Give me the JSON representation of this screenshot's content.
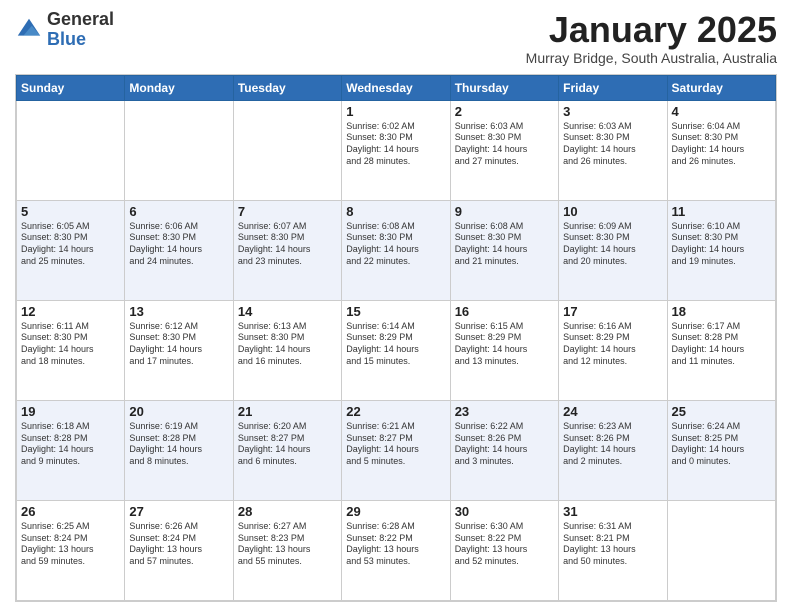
{
  "logo": {
    "general": "General",
    "blue": "Blue"
  },
  "title": "January 2025",
  "location": "Murray Bridge, South Australia, Australia",
  "weekdays": [
    "Sunday",
    "Monday",
    "Tuesday",
    "Wednesday",
    "Thursday",
    "Friday",
    "Saturday"
  ],
  "weeks": [
    [
      {
        "day": "",
        "info": ""
      },
      {
        "day": "",
        "info": ""
      },
      {
        "day": "",
        "info": ""
      },
      {
        "day": "1",
        "info": "Sunrise: 6:02 AM\nSunset: 8:30 PM\nDaylight: 14 hours\nand 28 minutes."
      },
      {
        "day": "2",
        "info": "Sunrise: 6:03 AM\nSunset: 8:30 PM\nDaylight: 14 hours\nand 27 minutes."
      },
      {
        "day": "3",
        "info": "Sunrise: 6:03 AM\nSunset: 8:30 PM\nDaylight: 14 hours\nand 26 minutes."
      },
      {
        "day": "4",
        "info": "Sunrise: 6:04 AM\nSunset: 8:30 PM\nDaylight: 14 hours\nand 26 minutes."
      }
    ],
    [
      {
        "day": "5",
        "info": "Sunrise: 6:05 AM\nSunset: 8:30 PM\nDaylight: 14 hours\nand 25 minutes."
      },
      {
        "day": "6",
        "info": "Sunrise: 6:06 AM\nSunset: 8:30 PM\nDaylight: 14 hours\nand 24 minutes."
      },
      {
        "day": "7",
        "info": "Sunrise: 6:07 AM\nSunset: 8:30 PM\nDaylight: 14 hours\nand 23 minutes."
      },
      {
        "day": "8",
        "info": "Sunrise: 6:08 AM\nSunset: 8:30 PM\nDaylight: 14 hours\nand 22 minutes."
      },
      {
        "day": "9",
        "info": "Sunrise: 6:08 AM\nSunset: 8:30 PM\nDaylight: 14 hours\nand 21 minutes."
      },
      {
        "day": "10",
        "info": "Sunrise: 6:09 AM\nSunset: 8:30 PM\nDaylight: 14 hours\nand 20 minutes."
      },
      {
        "day": "11",
        "info": "Sunrise: 6:10 AM\nSunset: 8:30 PM\nDaylight: 14 hours\nand 19 minutes."
      }
    ],
    [
      {
        "day": "12",
        "info": "Sunrise: 6:11 AM\nSunset: 8:30 PM\nDaylight: 14 hours\nand 18 minutes."
      },
      {
        "day": "13",
        "info": "Sunrise: 6:12 AM\nSunset: 8:30 PM\nDaylight: 14 hours\nand 17 minutes."
      },
      {
        "day": "14",
        "info": "Sunrise: 6:13 AM\nSunset: 8:30 PM\nDaylight: 14 hours\nand 16 minutes."
      },
      {
        "day": "15",
        "info": "Sunrise: 6:14 AM\nSunset: 8:29 PM\nDaylight: 14 hours\nand 15 minutes."
      },
      {
        "day": "16",
        "info": "Sunrise: 6:15 AM\nSunset: 8:29 PM\nDaylight: 14 hours\nand 13 minutes."
      },
      {
        "day": "17",
        "info": "Sunrise: 6:16 AM\nSunset: 8:29 PM\nDaylight: 14 hours\nand 12 minutes."
      },
      {
        "day": "18",
        "info": "Sunrise: 6:17 AM\nSunset: 8:28 PM\nDaylight: 14 hours\nand 11 minutes."
      }
    ],
    [
      {
        "day": "19",
        "info": "Sunrise: 6:18 AM\nSunset: 8:28 PM\nDaylight: 14 hours\nand 9 minutes."
      },
      {
        "day": "20",
        "info": "Sunrise: 6:19 AM\nSunset: 8:28 PM\nDaylight: 14 hours\nand 8 minutes."
      },
      {
        "day": "21",
        "info": "Sunrise: 6:20 AM\nSunset: 8:27 PM\nDaylight: 14 hours\nand 6 minutes."
      },
      {
        "day": "22",
        "info": "Sunrise: 6:21 AM\nSunset: 8:27 PM\nDaylight: 14 hours\nand 5 minutes."
      },
      {
        "day": "23",
        "info": "Sunrise: 6:22 AM\nSunset: 8:26 PM\nDaylight: 14 hours\nand 3 minutes."
      },
      {
        "day": "24",
        "info": "Sunrise: 6:23 AM\nSunset: 8:26 PM\nDaylight: 14 hours\nand 2 minutes."
      },
      {
        "day": "25",
        "info": "Sunrise: 6:24 AM\nSunset: 8:25 PM\nDaylight: 14 hours\nand 0 minutes."
      }
    ],
    [
      {
        "day": "26",
        "info": "Sunrise: 6:25 AM\nSunset: 8:24 PM\nDaylight: 13 hours\nand 59 minutes."
      },
      {
        "day": "27",
        "info": "Sunrise: 6:26 AM\nSunset: 8:24 PM\nDaylight: 13 hours\nand 57 minutes."
      },
      {
        "day": "28",
        "info": "Sunrise: 6:27 AM\nSunset: 8:23 PM\nDaylight: 13 hours\nand 55 minutes."
      },
      {
        "day": "29",
        "info": "Sunrise: 6:28 AM\nSunset: 8:22 PM\nDaylight: 13 hours\nand 53 minutes."
      },
      {
        "day": "30",
        "info": "Sunrise: 6:30 AM\nSunset: 8:22 PM\nDaylight: 13 hours\nand 52 minutes."
      },
      {
        "day": "31",
        "info": "Sunrise: 6:31 AM\nSunset: 8:21 PM\nDaylight: 13 hours\nand 50 minutes."
      },
      {
        "day": "",
        "info": ""
      }
    ]
  ]
}
